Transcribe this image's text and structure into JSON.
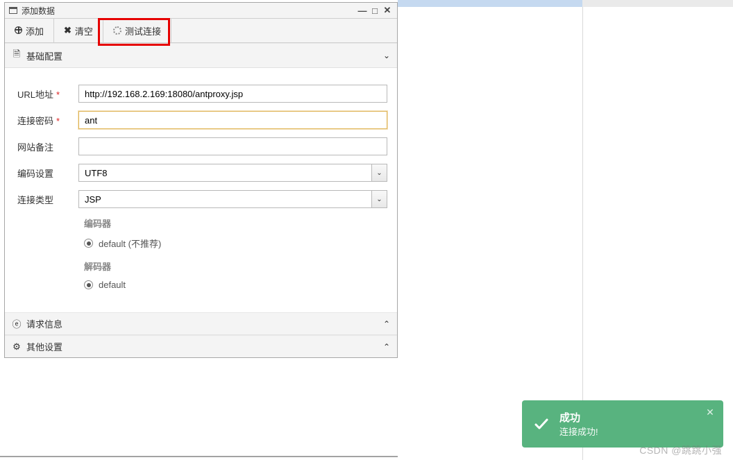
{
  "dialog": {
    "title": "添加数据"
  },
  "toolbar": {
    "add_label": "添加",
    "clear_label": "清空",
    "test_label": "测试连接"
  },
  "sections": {
    "basic": "基础配置",
    "request": "请求信息",
    "other": "其他设置"
  },
  "form": {
    "url_label": "URL地址",
    "url_value": "http://192.168.2.169:18080/antproxy.jsp",
    "password_label": "连接密码",
    "password_value": "ant",
    "note_label": "网站备注",
    "note_value": "",
    "encoding_label": "编码设置",
    "encoding_value": "UTF8",
    "conntype_label": "连接类型",
    "conntype_value": "JSP",
    "encoder_title": "编码器",
    "encoder_option": "default (不推荐)",
    "decoder_title": "解码器",
    "decoder_option": "default"
  },
  "toast": {
    "title": "成功",
    "message": "连接成功!"
  },
  "watermark": "CSDN @跳跳小强"
}
